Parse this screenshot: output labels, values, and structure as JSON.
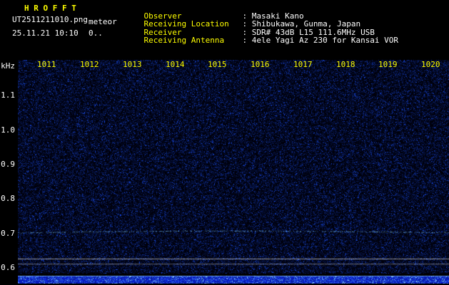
{
  "app": {
    "title": "H R O F F T",
    "file_name": "UT2511211010.png",
    "observation_name": "meteor",
    "date_time": "25.11.21 10:10",
    "counter": "0.."
  },
  "info": {
    "rows": [
      {
        "label": "Observer",
        "value": ": Masaki Kano"
      },
      {
        "label": "Receiving Location",
        "value": ": Shibukawa, Gunma, Japan"
      },
      {
        "label": "Receiver",
        "value": ": SDR# 43dB L15 111.6MHz USB"
      },
      {
        "label": "Receiving Antenna",
        "value": ": 4ele Yagi Az 230 for Kansai VOR"
      }
    ]
  },
  "chart_data": {
    "type": "heatmap",
    "subtype": "radio meteor-echo spectrogram (HROFFT waterfall)",
    "title": "",
    "x": {
      "tick_labels": [
        "1011",
        "1012",
        "1013",
        "1014",
        "1015",
        "1016",
        "1017",
        "1018",
        "1019",
        "1020"
      ],
      "unit": "UT time, one-minute steps"
    },
    "y": {
      "unit": "kHz",
      "tick_labels": [
        "1.1",
        "1.0",
        "0.9",
        "0.8",
        "0.7",
        "0.6"
      ],
      "range": [
        0.58,
        1.2
      ]
    },
    "series_notes": "uniform dark-blue background noise across all ten minutes; faint dotted carrier trace near 0.7 kHz; no meteor echo streaks; bright blue signal-level strip along bottom edge",
    "features": {
      "carrier_line_khz": 0.7,
      "reference_lines_khz": [
        0.624,
        0.609
      ],
      "signal_level_band": "bright blue speckled strip at bottom of plot"
    },
    "colors": {
      "background": "#000000",
      "label_yellow": "#ffff00",
      "text_white": "#ffffff",
      "noise_blue": "#0a1a66",
      "carrier_cyan": "#7ecbff",
      "reference_white": "#ffffff",
      "band_blue": "#0a1cc8",
      "band_speckle": "#3c78ff",
      "band_speckle_bright": "#9adcff"
    }
  }
}
